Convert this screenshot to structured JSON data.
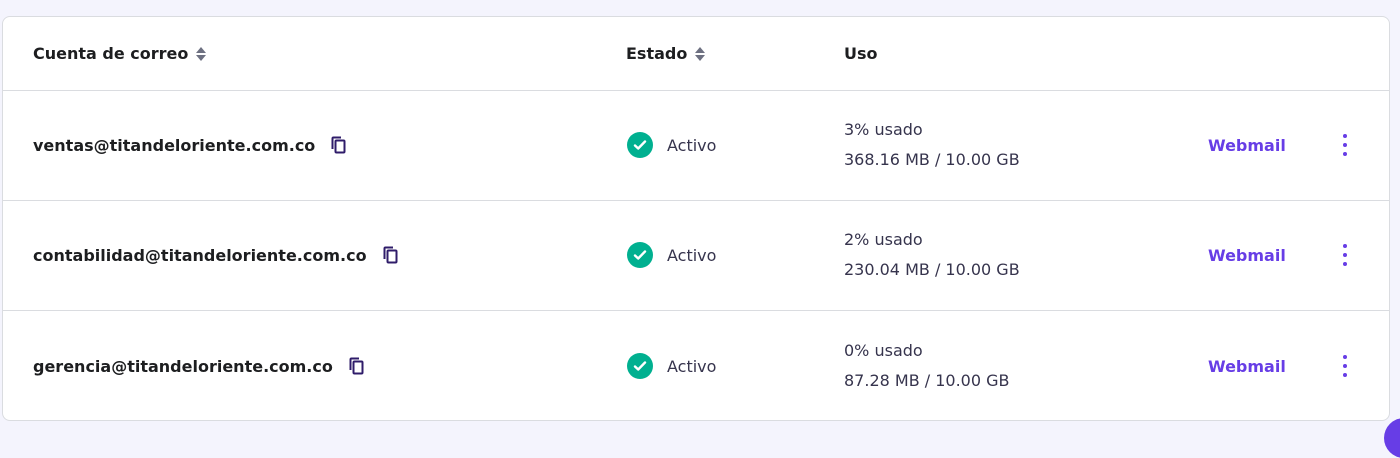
{
  "table": {
    "columns": {
      "account": "Cuenta de correo",
      "status": "Estado",
      "usage": "Uso"
    },
    "rows": [
      {
        "email": "ventas@titandeloriente.com.co",
        "status": "Activo",
        "usage_percent": "3% usado",
        "usage_amount": "368.16 MB / 10.00 GB",
        "action": "Webmail"
      },
      {
        "email": "contabilidad@titandeloriente.com.co",
        "status": "Activo",
        "usage_percent": "2% usado",
        "usage_amount": "230.04 MB / 10.00 GB",
        "action": "Webmail"
      },
      {
        "email": "gerencia@titandeloriente.com.co",
        "status": "Activo",
        "usage_percent": "0% usado",
        "usage_amount": "87.28 MB / 10.00 GB",
        "action": "Webmail"
      }
    ]
  },
  "icons": {
    "sort": "sort-icon",
    "copy": "copy-icon",
    "status": "check-circle-icon",
    "more": "more-vertical-icon"
  },
  "colors": {
    "accent": "#673de6",
    "success": "#00b090",
    "text": "#1d1e20",
    "background": "#f4f4fd"
  }
}
